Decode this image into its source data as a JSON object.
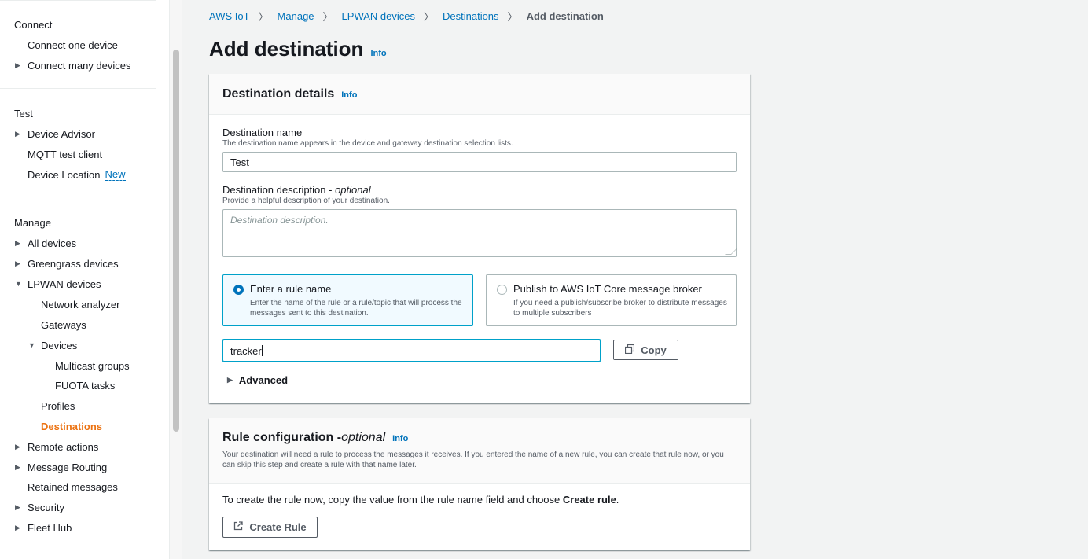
{
  "sidebar": {
    "connect": {
      "heading": "Connect",
      "items": [
        {
          "label": "Connect one device"
        },
        {
          "label": "Connect many devices"
        }
      ]
    },
    "test": {
      "heading": "Test",
      "items": [
        {
          "label": "Device Advisor"
        },
        {
          "label": "MQTT test client"
        },
        {
          "label": "Device Location",
          "badge": "New"
        }
      ]
    },
    "manage": {
      "heading": "Manage",
      "items": [
        {
          "label": "All devices"
        },
        {
          "label": "Greengrass devices"
        },
        {
          "label": "LPWAN devices"
        },
        {
          "label": "Network analyzer"
        },
        {
          "label": "Gateways"
        },
        {
          "label": "Devices"
        },
        {
          "label": "Multicast groups"
        },
        {
          "label": "FUOTA tasks"
        },
        {
          "label": "Profiles"
        },
        {
          "label": "Destinations"
        },
        {
          "label": "Remote actions"
        },
        {
          "label": "Message Routing"
        },
        {
          "label": "Retained messages"
        },
        {
          "label": "Security"
        },
        {
          "label": "Fleet Hub"
        }
      ]
    }
  },
  "breadcrumb": {
    "items": [
      "AWS IoT",
      "Manage",
      "LPWAN devices",
      "Destinations"
    ],
    "current": "Add destination"
  },
  "page": {
    "title": "Add destination",
    "info": "Info"
  },
  "details": {
    "title": "Destination details",
    "info": "Info",
    "name_label": "Destination name",
    "name_desc": "The destination name appears in the device and gateway destination selection lists.",
    "name_value": "Test",
    "desc_label": "Destination description - ",
    "desc_label_optional": "optional",
    "desc_desc": "Provide a helpful description of your destination.",
    "desc_placeholder": "Destination description.",
    "tile_rule": {
      "title": "Enter a rule name",
      "desc": "Enter the name of the rule or a rule/topic that will process the messages sent to this destination.",
      "selected": true
    },
    "tile_publish": {
      "title": "Publish to AWS IoT Core message broker",
      "desc": "If you need a publish/subscribe broker to distribute messages to multiple subscribers",
      "selected": false
    },
    "rule_value": "tracker",
    "copy_label": "Copy",
    "advanced_label": "Advanced"
  },
  "rule_config": {
    "title": "Rule configuration -",
    "title_optional": "optional",
    "info": "Info",
    "desc": "Your destination will need a rule to process the messages it receives. If you entered the name of a new rule, you can create that rule now, or you can skip this step and create a rule with that name later.",
    "body_prefix": "To create the rule now, copy the value from the rule name field and choose ",
    "body_bold": "Create rule",
    "body_suffix": ".",
    "button_label": "Create Rule"
  },
  "colors": {
    "link": "#0073bb",
    "active_nav": "#ec7211",
    "selected_border": "#00a1c9",
    "selected_bg": "#f1faff"
  }
}
